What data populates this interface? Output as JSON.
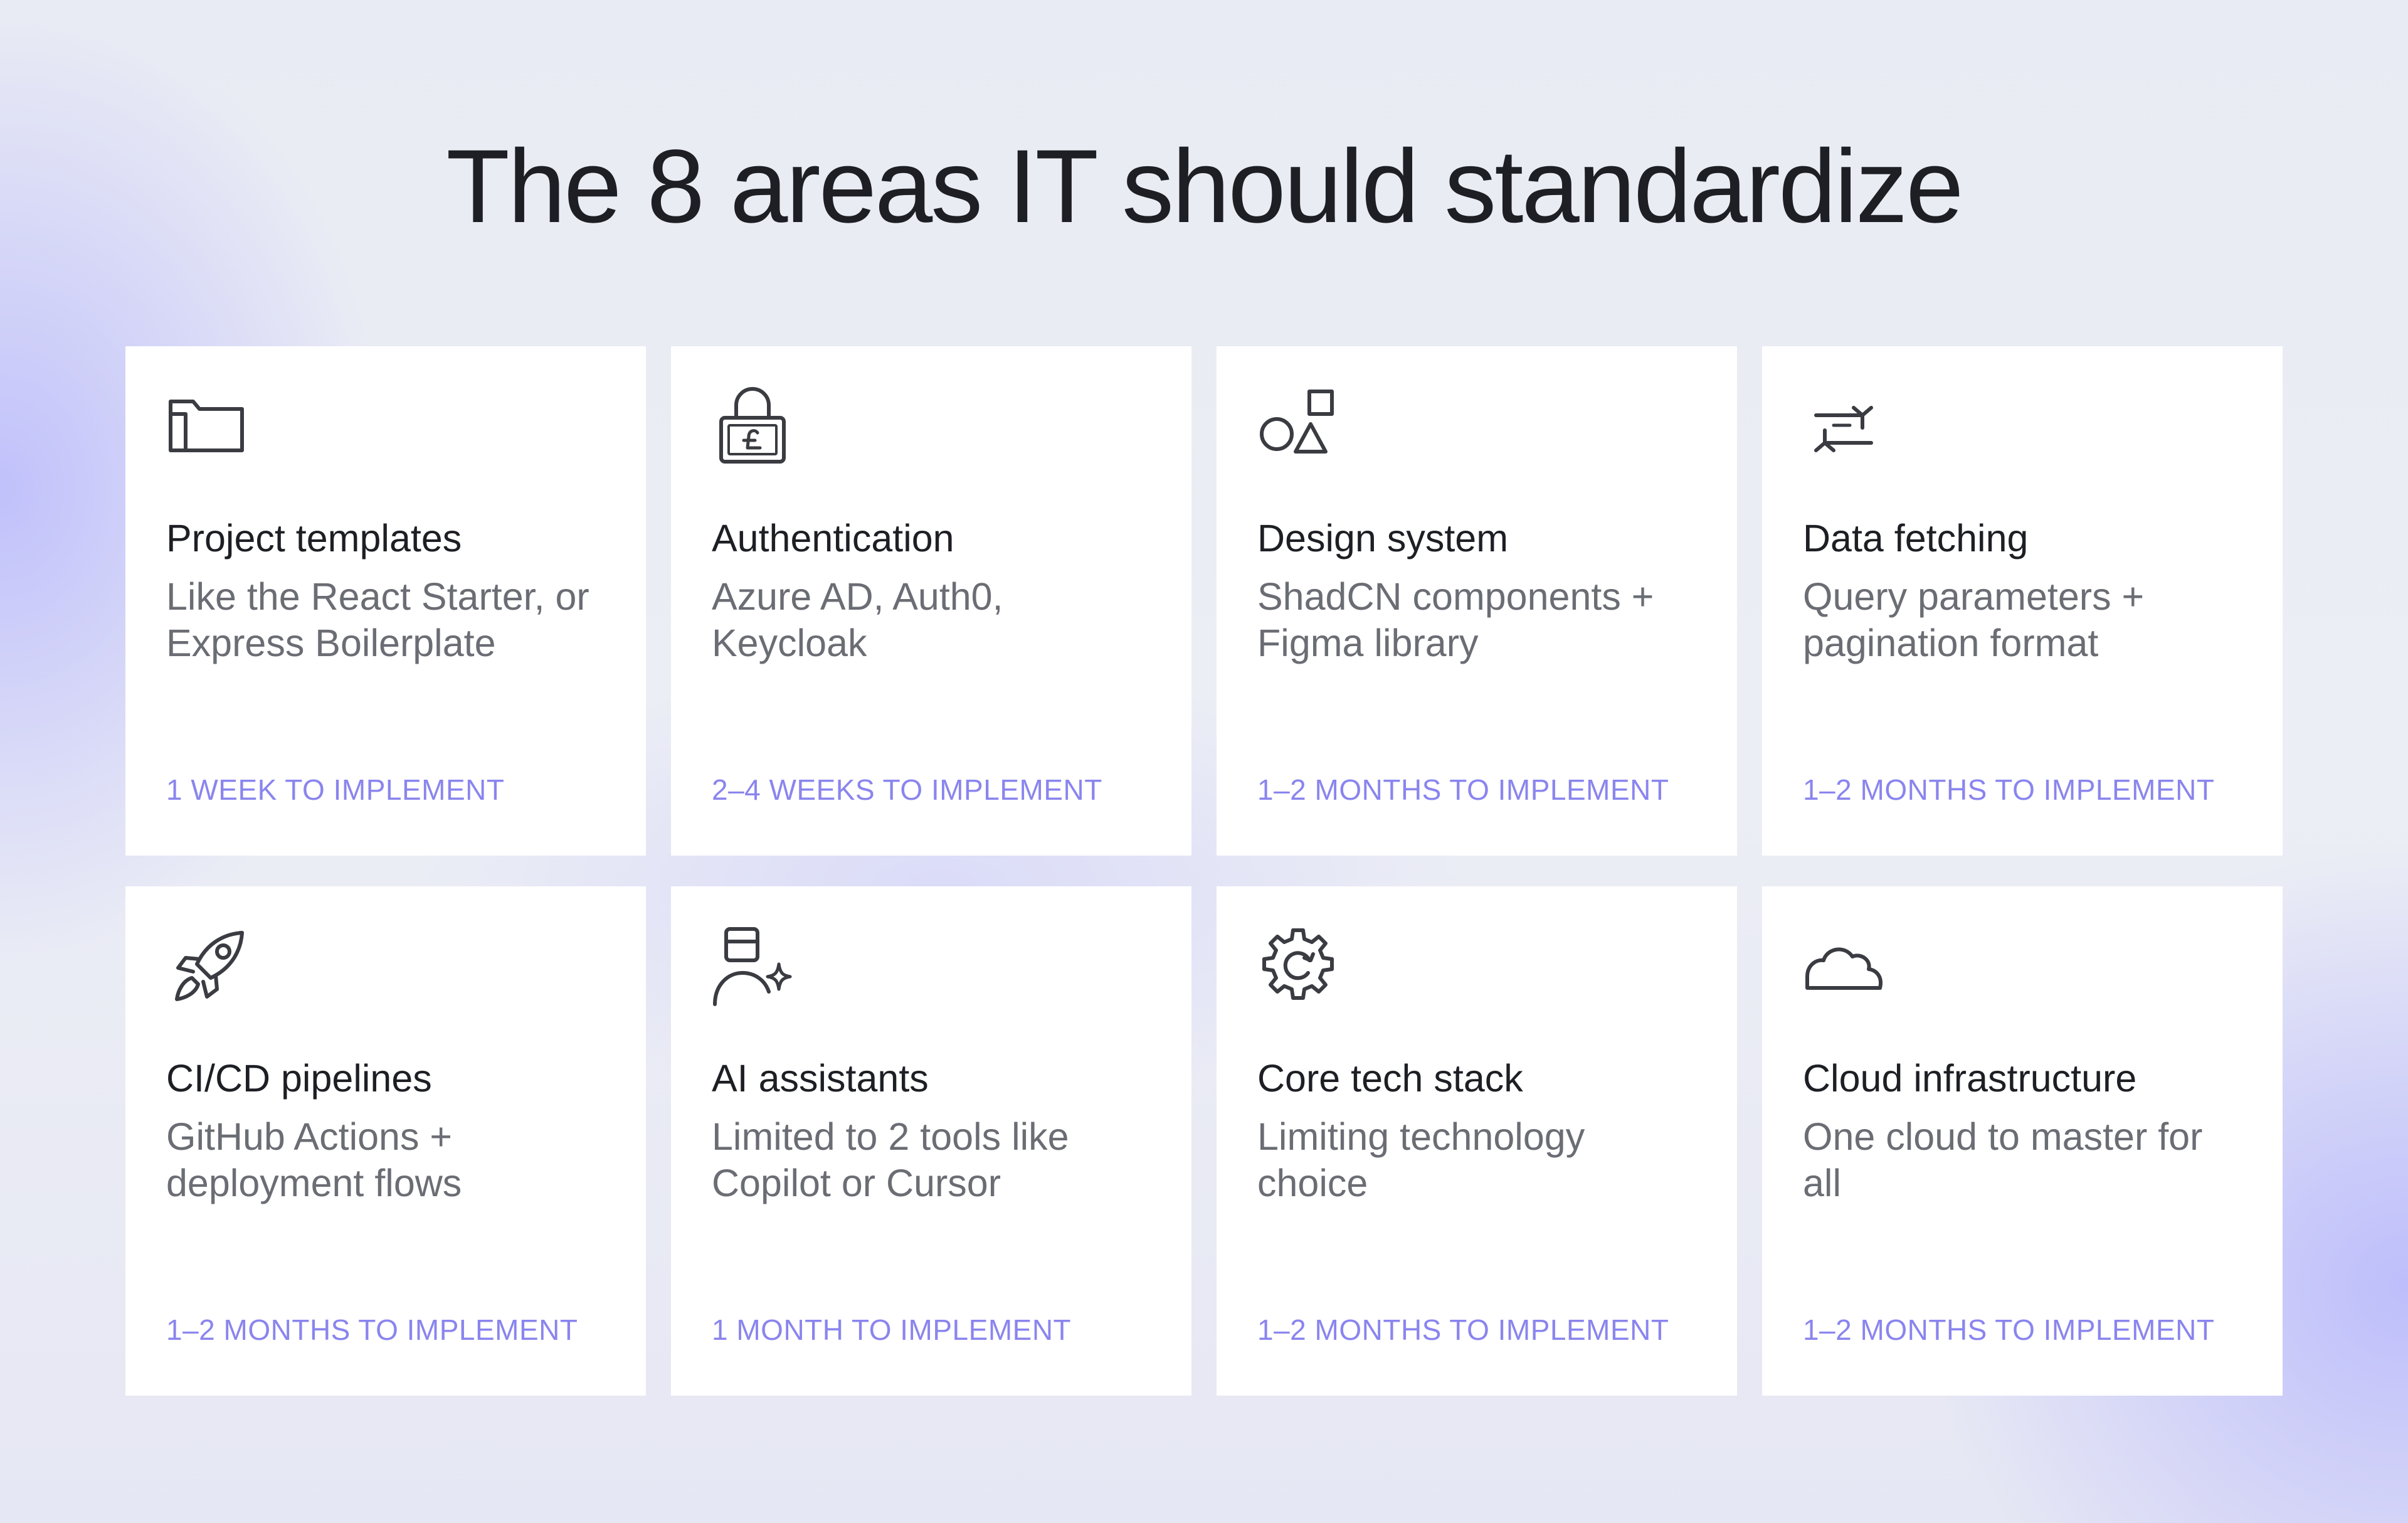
{
  "title": "The 8 areas IT should standardize",
  "colors": {
    "accent": "#8a85ee",
    "text": "#1d1f24",
    "muted": "#6b6d74",
    "card": "#ffffff"
  },
  "cards": [
    {
      "icon": "folder-icon",
      "title": "Project templates",
      "description": "Like the React Starter, or Express Boilerplate",
      "time": "1 WEEK TO IMPLEMENT"
    },
    {
      "icon": "lock-icon",
      "title": "Authentication",
      "description": "Azure AD, Auth0, Keycloak",
      "time": "2–4 WEEKS TO IMPLEMENT"
    },
    {
      "icon": "shapes-icon",
      "title": "Design system",
      "description": "ShadCN components + Figma library",
      "time": "1–2 MONTHS TO IMPLEMENT"
    },
    {
      "icon": "sync-arrows-icon",
      "title": "Data fetching",
      "description": "Query parameters + pagination format",
      "time": "1–2 MONTHS TO IMPLEMENT"
    },
    {
      "icon": "rocket-icon",
      "title": "CI/CD pipelines",
      "description": "GitHub Actions + deployment flows",
      "time": "1–2 MONTHS TO IMPLEMENT"
    },
    {
      "icon": "ai-user-icon",
      "title": "AI assistants",
      "description": "Limited to 2 tools like Copilot or Cursor",
      "time": "1 MONTH TO IMPLEMENT"
    },
    {
      "icon": "gear-icon",
      "title": "Core tech stack",
      "description": "Limiting technology choice",
      "time": "1–2 MONTHS TO IMPLEMENT"
    },
    {
      "icon": "cloud-icon",
      "title": "Cloud infrastructure",
      "description": "One cloud to master for all",
      "time": "1–2 MONTHS TO IMPLEMENT"
    }
  ]
}
